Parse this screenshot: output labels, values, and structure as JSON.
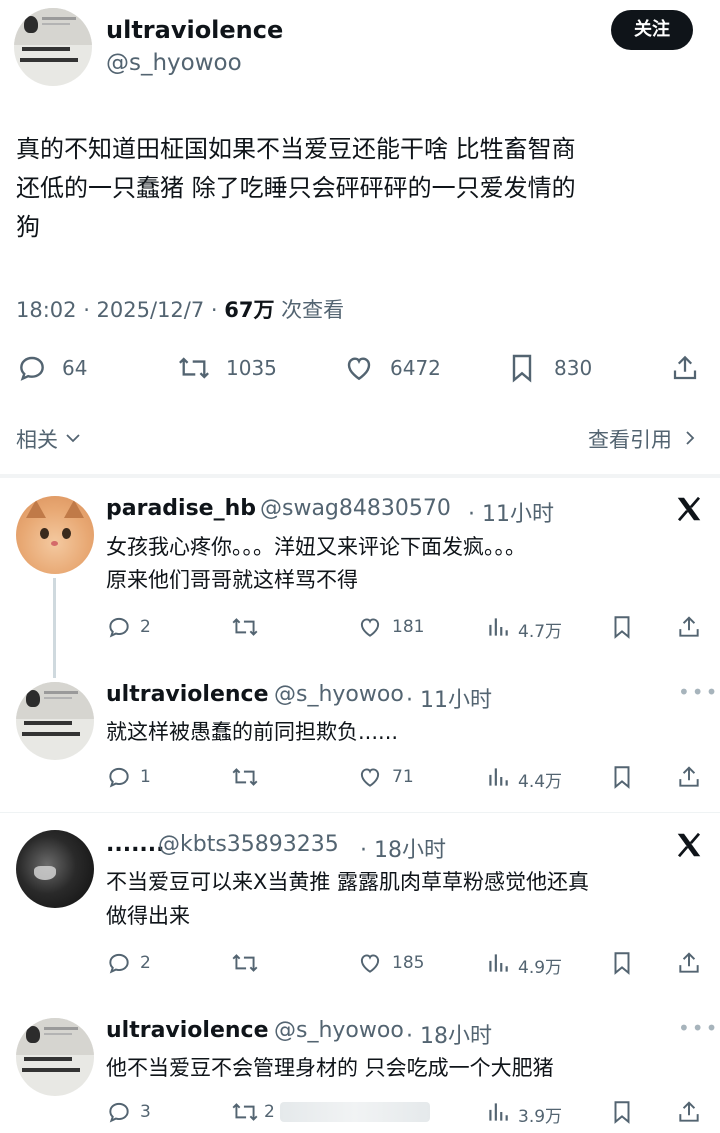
{
  "post": {
    "name": "ultraviolence",
    "handle": "@s_hyowoo",
    "follow_label": "关注",
    "body_lines": [
      "真的不知道田柾国如果不当爱豆还能干啥 比牲畜智商",
      "还低的一只蠢猪 除了吃睡只会砰砰砰的一只爱发情的",
      "狗"
    ],
    "time_date": "18:02 · 2025/12/7 · ",
    "views_count": "67万",
    "views_suffix": " 次查看",
    "stats": {
      "replies": "64",
      "reposts": "1035",
      "likes": "6472",
      "bookmarks": "830"
    },
    "related_label": "相关",
    "quotes_label": "查看引用"
  },
  "avatar_text": {
    "line1": "你是个傻逼",
    "line2": "我现在确定了",
    "caption": "That's So True"
  },
  "replies": [
    {
      "name": "paradise_hb",
      "handle": "@swag84830570",
      "time": "· 11小时",
      "lines": [
        "女孩我心疼你。。。洋妞又来评论下面发疯。。。",
        "原来他们哥哥就这样骂不得"
      ],
      "stats": {
        "replies": "2",
        "reposts": "",
        "likes": "181",
        "views": "4.7万"
      },
      "badge_icon": "x-logo-icon"
    },
    {
      "name": "ultraviolence",
      "handle": "@s_hyowoo",
      "time": "· 11小时",
      "lines": [
        "就这样被愚蠢的前同担欺负......"
      ],
      "stats": {
        "replies": "1",
        "reposts": "",
        "likes": "71",
        "views": "4.4万"
      },
      "badge_icon": "more-icon"
    },
    {
      "name": ".......",
      "handle": "@kbts35893235",
      "time": "· 18小时",
      "lines": [
        "不当爱豆可以来X当黄推 露露肌肉草草粉感觉他还真",
        "做得出来"
      ],
      "stats": {
        "replies": "2",
        "reposts": "",
        "likes": "185",
        "views": "4.9万"
      },
      "badge_icon": "x-logo-icon"
    },
    {
      "name": "ultraviolence",
      "handle": "@s_hyowoo",
      "time": "· 18小时",
      "lines": [
        "他不当爱豆不会管理身材的 只会吃成一个大肥猪"
      ],
      "stats": {
        "replies": "3",
        "reposts": "2",
        "likes": "",
        "views": "3.9万"
      },
      "badge_icon": "more-icon"
    }
  ],
  "colors": {
    "text": "#0f1419",
    "secondary": "#536471",
    "divider": "#eff3f4",
    "button": "#0f1419"
  }
}
